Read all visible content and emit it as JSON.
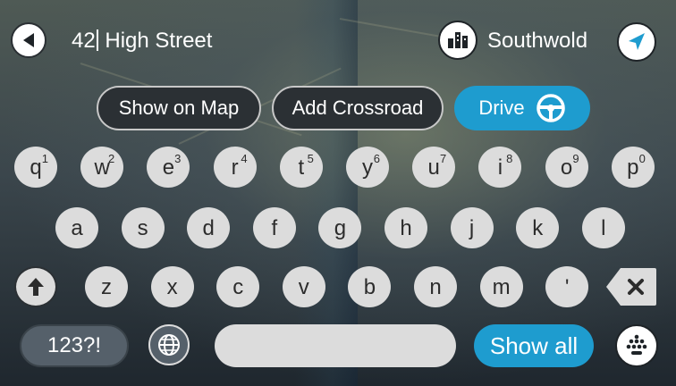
{
  "header": {
    "query_value": "42 High Street",
    "query_before_cursor": "42",
    "query_after_cursor": " High Street",
    "search_area": "Southwold"
  },
  "actions": {
    "show_on_map": "Show on Map",
    "add_crossroad": "Add Crossroad",
    "drive": "Drive"
  },
  "keyboard": {
    "row1": [
      {
        "key": "q",
        "sup": "1"
      },
      {
        "key": "w",
        "sup": "2"
      },
      {
        "key": "e",
        "sup": "3"
      },
      {
        "key": "r",
        "sup": "4"
      },
      {
        "key": "t",
        "sup": "5"
      },
      {
        "key": "y",
        "sup": "6"
      },
      {
        "key": "u",
        "sup": "7"
      },
      {
        "key": "i",
        "sup": "8"
      },
      {
        "key": "o",
        "sup": "9"
      },
      {
        "key": "p",
        "sup": "0"
      }
    ],
    "row2": [
      "a",
      "s",
      "d",
      "f",
      "g",
      "h",
      "j",
      "k",
      "l"
    ],
    "row3": [
      "z",
      "x",
      "c",
      "v",
      "b",
      "n",
      "m",
      "'"
    ],
    "numbers_label": "123?!",
    "show_all_label": "Show all"
  },
  "colors": {
    "accent": "#1e9ccf",
    "key_bg": "#dcdcdc",
    "dark_pill": "#2b3034"
  },
  "icons": {
    "back": "back-arrow-icon",
    "town": "town-buildings-icon",
    "navigate": "navigation-arrow-icon",
    "steering": "steering-wheel-icon",
    "shift": "shift-arrow-icon",
    "backspace": "backspace-icon",
    "globe": "globe-icon",
    "keyboard_toggle": "keyboard-icon"
  }
}
